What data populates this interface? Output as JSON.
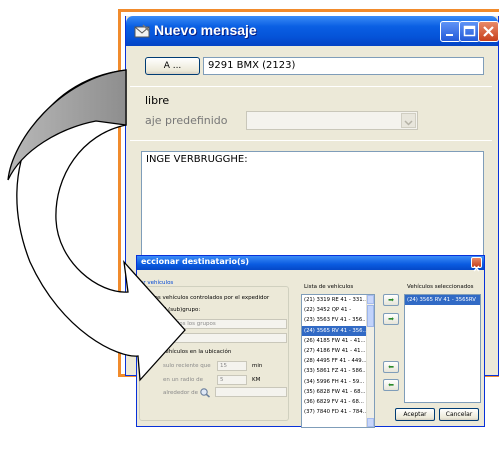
{
  "compose_window": {
    "title": "Nuevo mensaje",
    "to_button_label": "A ...",
    "to_value": "9291 BMX (2123)",
    "free_text_label": "libre",
    "predefined_label": "aje predefinido",
    "message_text": "INGE VERBRUGGHE:"
  },
  "recipient_dialog": {
    "title": "eccionar destinatario(s)",
    "vehicles_group_label": "ar vehículos",
    "option_expeditor": "os los vehículos controlados por el expedidor",
    "option_subgroup": "ulos del (sub)grupo:",
    "subgroup_combo_value": "Todos los grupos",
    "option_location": "Vehículos en la ubicación",
    "recent_label": "sulo reciente que",
    "recent_value": "15",
    "recent_unit": "min",
    "radius_label": "en un radio de",
    "radius_value": "5",
    "radius_unit": "KM",
    "around_label": "alrededor de",
    "vehicle_list_header": "Lista de vehículos",
    "vehicle_list": [
      "(21) 3319 RE 41 - 331...",
      "(22) 3452 QP 41 -",
      "(23) 3563 FV 41 - 356...",
      "(24) 3565 RV 41 - 356...",
      "(26) 4185 FW 41 - 41...",
      "(27) 4186 FW 41 - 41...",
      "(28) 4495 FF 41 - 449...",
      "(33) 5861 FZ 41 - 586...",
      "(34) 5996 FH 41 - 59...",
      "(35) 6828 FW 41 - 68...",
      "(36) 6829 FV 41 - 68...",
      "(37) 7840 FD 41 - 784..."
    ],
    "selected_list_index": 3,
    "selected_header": "Vehículos seleccionados",
    "selected_vehicles": [
      "(24) 3565 RV 41 - 3565RV"
    ],
    "accept_label": "Aceptar",
    "cancel_label": "Cancelar"
  },
  "colors": {
    "frame_orange": "#f18b2c",
    "xp_blue": "#0a5fe3",
    "selection": "#316ac5"
  }
}
